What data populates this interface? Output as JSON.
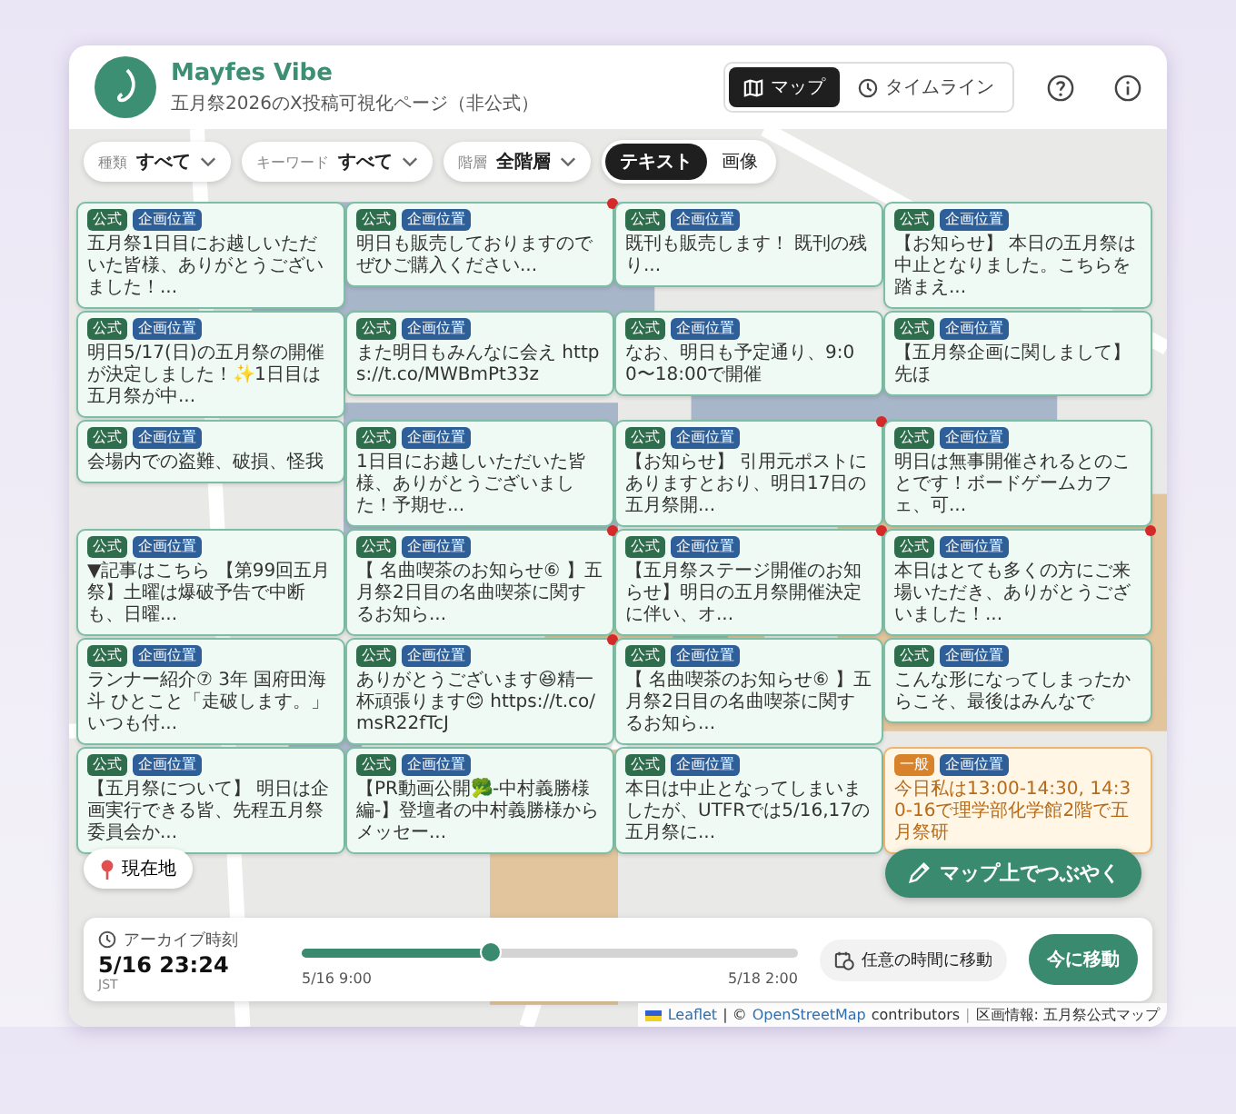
{
  "header": {
    "title": "Mayfes Vibe",
    "subtitle": "五月祭2026のX投稿可視化ページ（非公式）"
  },
  "views": [
    {
      "label": "マップ",
      "kind": "map",
      "selected": true
    },
    {
      "label": "タイムライン",
      "kind": "timeline",
      "selected": false
    }
  ],
  "filters": [
    {
      "label": "種類",
      "value": "すべて"
    },
    {
      "label": "キーワード",
      "value": "すべて"
    },
    {
      "label": "階層",
      "value": "全階層"
    }
  ],
  "display_modes": [
    {
      "label": "テキスト",
      "selected": true
    },
    {
      "label": "画像",
      "selected": false
    }
  ],
  "posts": [
    {
      "category": "公式",
      "kind": "official",
      "tag": "企画位置",
      "text": "五月祭1日目にお越しいただいた皆様、ありがとうございました！...",
      "marked": false
    },
    {
      "category": "公式",
      "kind": "official",
      "tag": "企画位置",
      "text": "明日も販売しておりますのでぜひご購入ください...",
      "marked": true
    },
    {
      "category": "公式",
      "kind": "official",
      "tag": "企画位置",
      "text": "既刊も販売します！ 既刊の残り...",
      "marked": false
    },
    {
      "category": "公式",
      "kind": "official",
      "tag": "企画位置",
      "text": "【お知らせ】 本日の五月祭は中止となりました。こちらを踏まえ...",
      "marked": false
    },
    {
      "category": "公式",
      "kind": "official",
      "tag": "企画位置",
      "text": "明日5/17(日)の五月祭の開催が決定しました！✨1日目は五月祭が中...",
      "marked": false
    },
    {
      "category": "公式",
      "kind": "official",
      "tag": "企画位置",
      "text": "また明日もみんなに会え https://t.co/MWBmPt33z",
      "marked": false
    },
    {
      "category": "公式",
      "kind": "official",
      "tag": "企画位置",
      "text": "なお、明日も予定通り、9:00〜18:00で開催",
      "marked": false
    },
    {
      "category": "公式",
      "kind": "official",
      "tag": "企画位置",
      "text": "【五月祭企画に関しまして】先ほ",
      "marked": false
    },
    {
      "category": "公式",
      "kind": "official",
      "tag": "企画位置",
      "text": "会場内での盗難、破損、怪我",
      "marked": false
    },
    {
      "category": "公式",
      "kind": "official",
      "tag": "企画位置",
      "text": "1日目にお越しいただいた皆様、ありがとうございました！予期せ...",
      "marked": false
    },
    {
      "category": "公式",
      "kind": "official",
      "tag": "企画位置",
      "text": "【お知らせ】 引用元ポストにありますとおり、明日17日の五月祭開...",
      "marked": true
    },
    {
      "category": "公式",
      "kind": "official",
      "tag": "企画位置",
      "text": "明日は無事開催されるとのことです！ボードゲームカフェ、可...",
      "marked": false
    },
    {
      "category": "公式",
      "kind": "official",
      "tag": "企画位置",
      "text": "▼記事はこちら 【第99回五月祭】土曜は爆破予告で中断も、日曜...",
      "marked": false
    },
    {
      "category": "公式",
      "kind": "official",
      "tag": "企画位置",
      "text": "【 名曲喫茶のお知らせ⑥ 】五月祭2日目の名曲喫茶に関するお知ら...",
      "marked": true
    },
    {
      "category": "公式",
      "kind": "official",
      "tag": "企画位置",
      "text": "【五月祭ステージ開催のお知らせ】明日の五月祭開催決定に伴い、オ...",
      "marked": true
    },
    {
      "category": "公式",
      "kind": "official",
      "tag": "企画位置",
      "text": "本日はとても多くの方にご来場いただき、ありがとうございました！...",
      "marked": true
    },
    {
      "category": "公式",
      "kind": "official",
      "tag": "企画位置",
      "text": "ランナー紹介⑦ 3年 国府田海斗 ひとこと「走破します。」いつも付...",
      "marked": false
    },
    {
      "category": "公式",
      "kind": "official",
      "tag": "企画位置",
      "text": "ありがとうございます😆精一杯頑張ります😊 https://t.co/msR22fTcJ",
      "marked": true
    },
    {
      "category": "公式",
      "kind": "official",
      "tag": "企画位置",
      "text": "【 名曲喫茶のお知らせ⑥ 】五月祭2日目の名曲喫茶に関するお知ら...",
      "marked": false
    },
    {
      "category": "公式",
      "kind": "official",
      "tag": "企画位置",
      "text": "こんな形になってしまったからこそ、最後はみんなで",
      "marked": false
    },
    {
      "category": "公式",
      "kind": "official",
      "tag": "企画位置",
      "text": "【五月祭について】 明日は企画実行できる皆、先程五月祭委員会か...",
      "marked": false
    },
    {
      "category": "公式",
      "kind": "official",
      "tag": "企画位置",
      "text": "【PR動画公開🥦-中村義勝様編-】登壇者の中村義勝様からメッセー...",
      "marked": false
    },
    {
      "category": "公式",
      "kind": "official",
      "tag": "企画位置",
      "text": "本日は中止となってしまいましたが、UTFRでは5/16,17の五月祭に...",
      "marked": false
    },
    {
      "category": "一般",
      "kind": "general",
      "tag": "企画位置",
      "text": "今日私は13:00-14:30, 14:30-16で理学部化学館2階で五月祭研",
      "marked": false
    }
  ],
  "locate_button": "現在地",
  "post_button": "マップ上でつぶやく",
  "archive": {
    "label": "アーカイブ時刻",
    "time": "5/16 23:24",
    "zone": "JST",
    "level": 0.38,
    "start": "5/16 9:00",
    "end": "5/18 2:00",
    "jump_button": "任意の時間に移動",
    "now_button": "今に移動"
  },
  "attribution": {
    "library": "Leaflet",
    "osm_prefix": "| ©",
    "osm": "OpenStreetMap",
    "osm_suffix": "contributors",
    "divider": "|",
    "sections": "区画情報: 五月祭公式マップ"
  }
}
